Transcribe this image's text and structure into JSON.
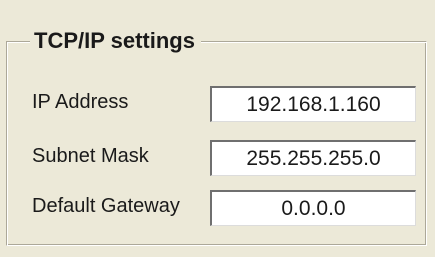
{
  "group": {
    "title": "TCP/IP settings"
  },
  "fields": [
    {
      "label": "IP Address",
      "value": "192.168.1.160"
    },
    {
      "label": "Subnet Mask",
      "value": "255.255.255.0"
    },
    {
      "label": "Default Gateway",
      "value": "0.0.0.0"
    }
  ]
}
